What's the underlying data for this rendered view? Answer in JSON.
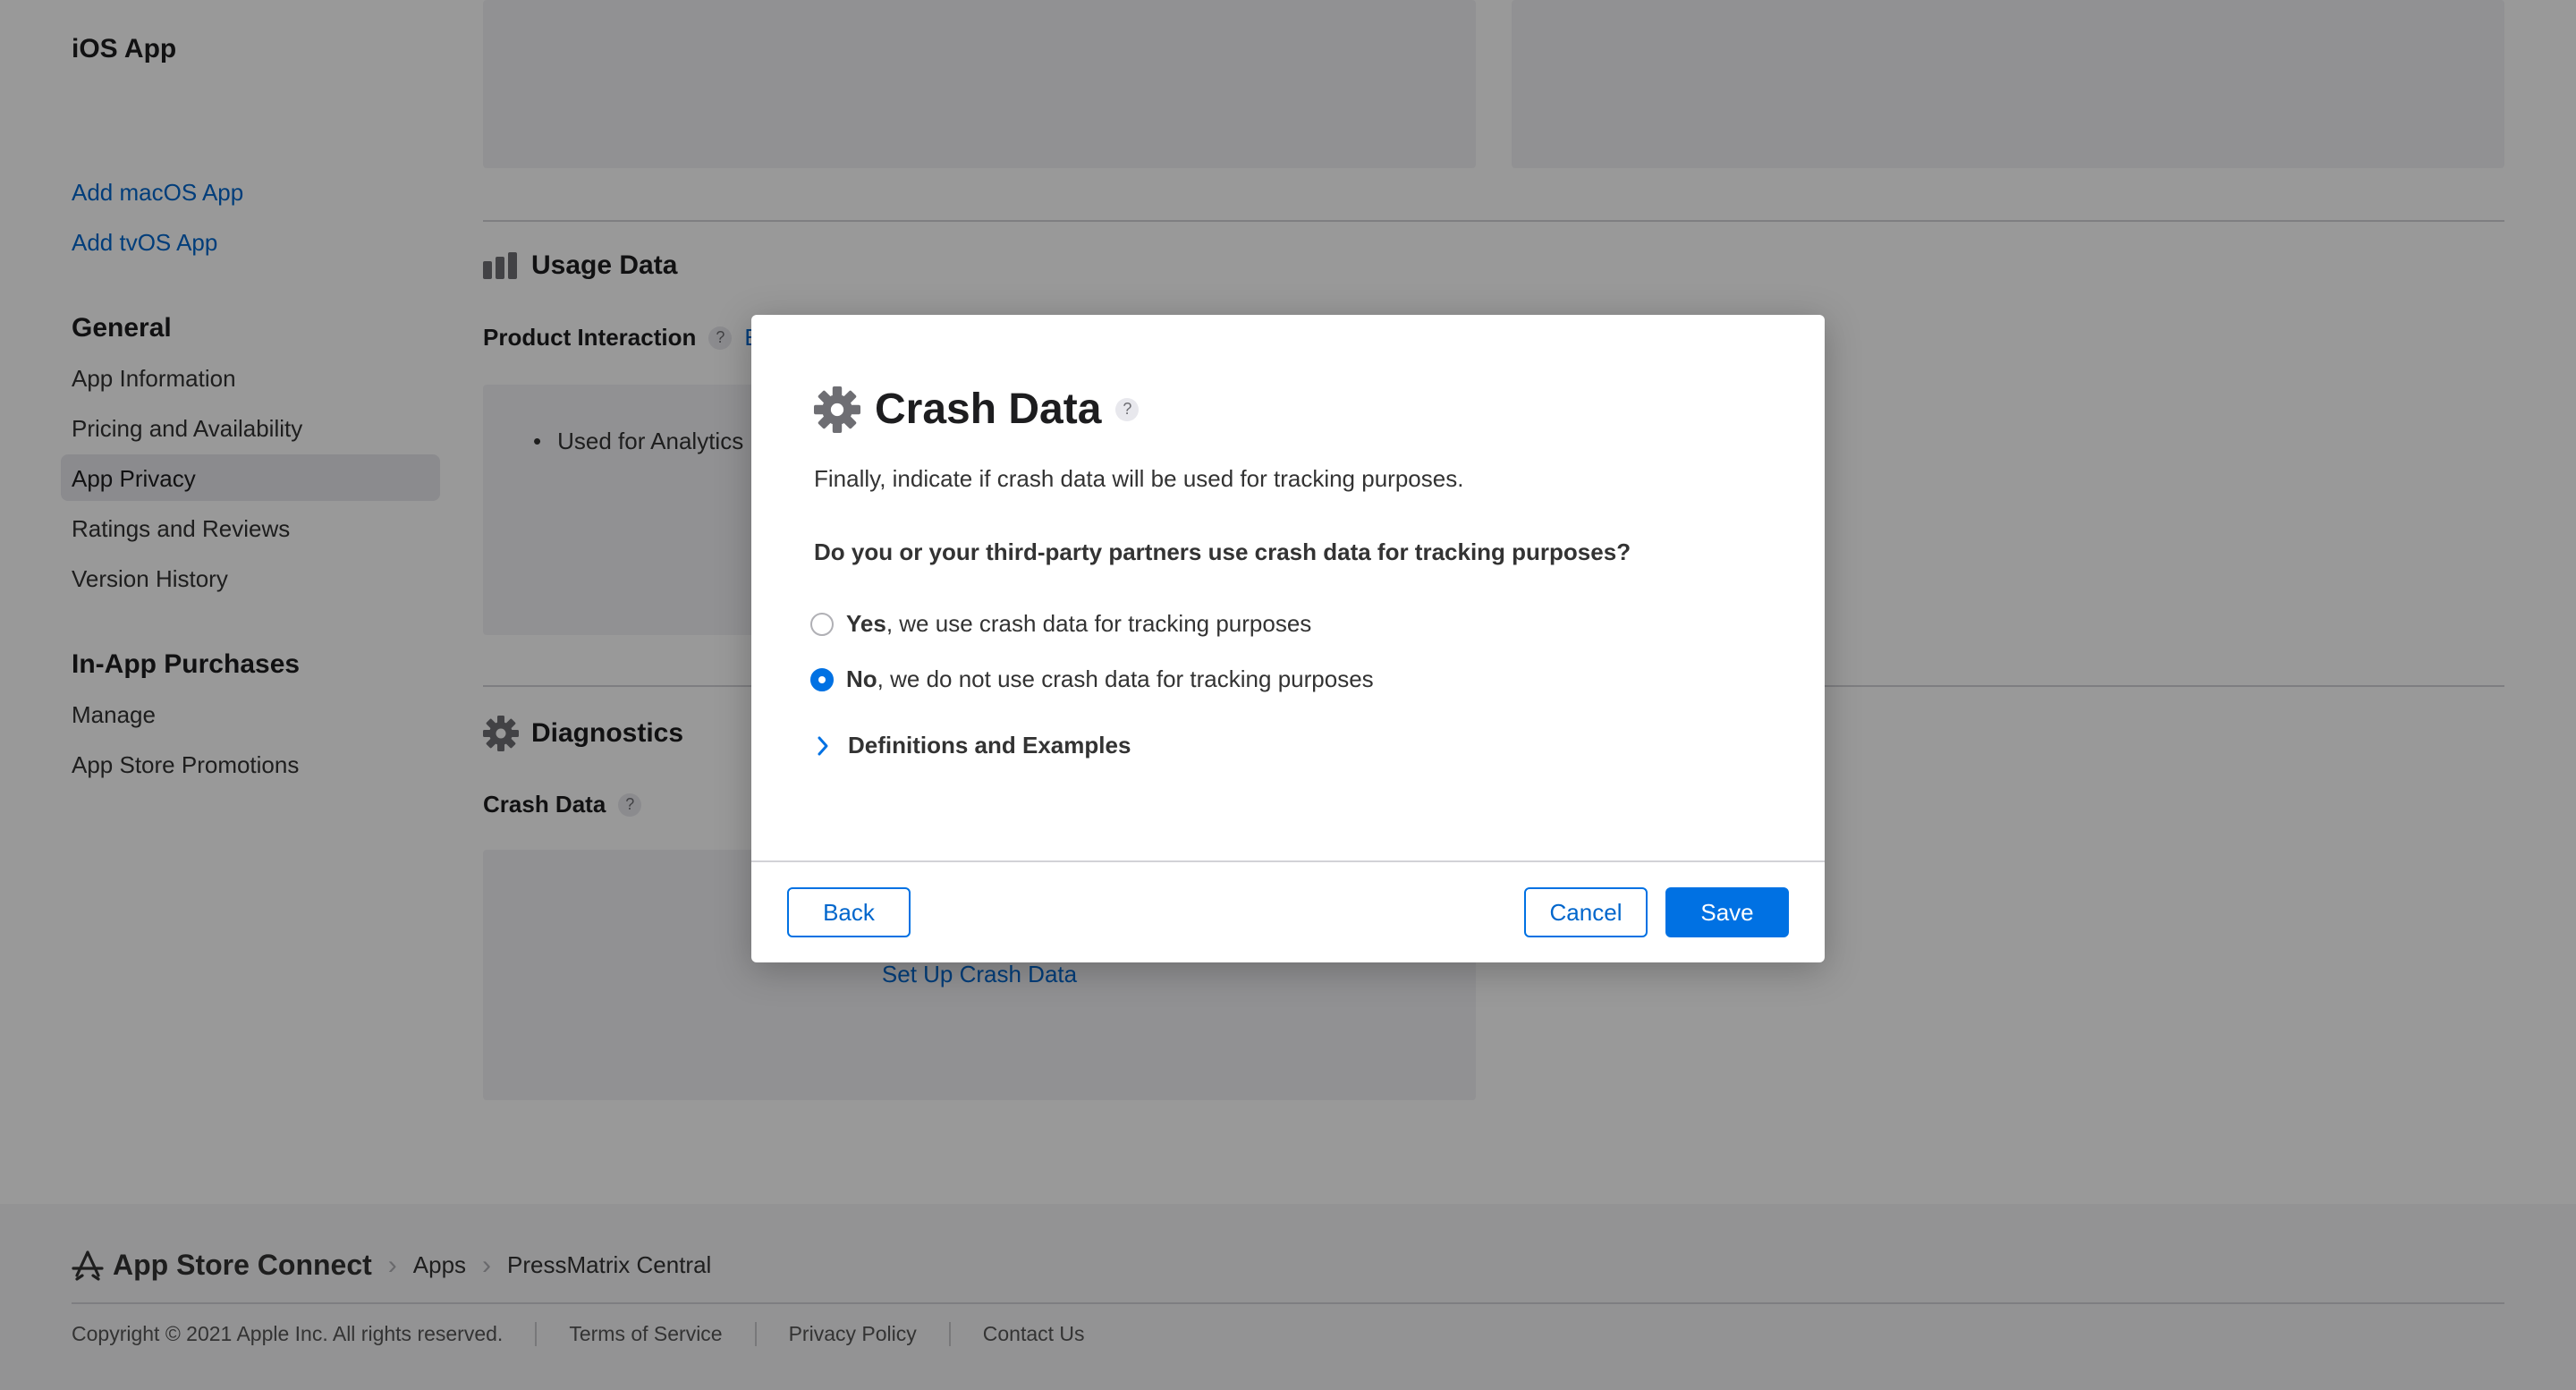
{
  "sidebar": {
    "platform_title": "iOS App",
    "add_links": [
      "Add macOS App",
      "Add tvOS App"
    ],
    "general_heading": "General",
    "general_items": [
      "App Information",
      "Pricing and Availability",
      "App Privacy",
      "Ratings and Reviews",
      "Version History"
    ],
    "selected_item": "App Privacy",
    "iap_heading": "In-App Purchases",
    "iap_items": [
      "Manage",
      "App Store Promotions"
    ]
  },
  "main": {
    "usage_section": {
      "title": "Usage Data",
      "icon": "bar-chart-icon",
      "product_interaction_label": "Product Interaction",
      "product_interaction_link": "E",
      "bullet": "Used for Analytics"
    },
    "diagnostics_section": {
      "title": "Diagnostics",
      "icon": "gear-icon",
      "crash_label": "Crash Data",
      "setup_link": "Set Up Crash Data"
    }
  },
  "modal": {
    "title": "Crash Data",
    "icon": "gear-icon",
    "description": "Finally, indicate if crash data will be used for tracking purposes.",
    "question": "Do you or your third-party partners use crash data for tracking purposes?",
    "options": [
      {
        "bold": "Yes",
        "rest": ", we use crash data for tracking purposes",
        "selected": false
      },
      {
        "bold": "No",
        "rest": ", we do not use crash data for tracking purposes",
        "selected": true
      }
    ],
    "disclosure_label": "Definitions and Examples",
    "buttons": {
      "back": "Back",
      "cancel": "Cancel",
      "save": "Save"
    }
  },
  "footer": {
    "brand": "App Store Connect",
    "breadcrumb": [
      "Apps",
      "PressMatrix Central"
    ],
    "copyright": "Copyright © 2021 Apple Inc. All rights reserved.",
    "links": [
      "Terms of Service",
      "Privacy Policy",
      "Contact Us"
    ]
  },
  "colors": {
    "accent": "#0071e3",
    "link": "#0066cc",
    "overlay": "rgba(0,0,0,0.4)"
  }
}
